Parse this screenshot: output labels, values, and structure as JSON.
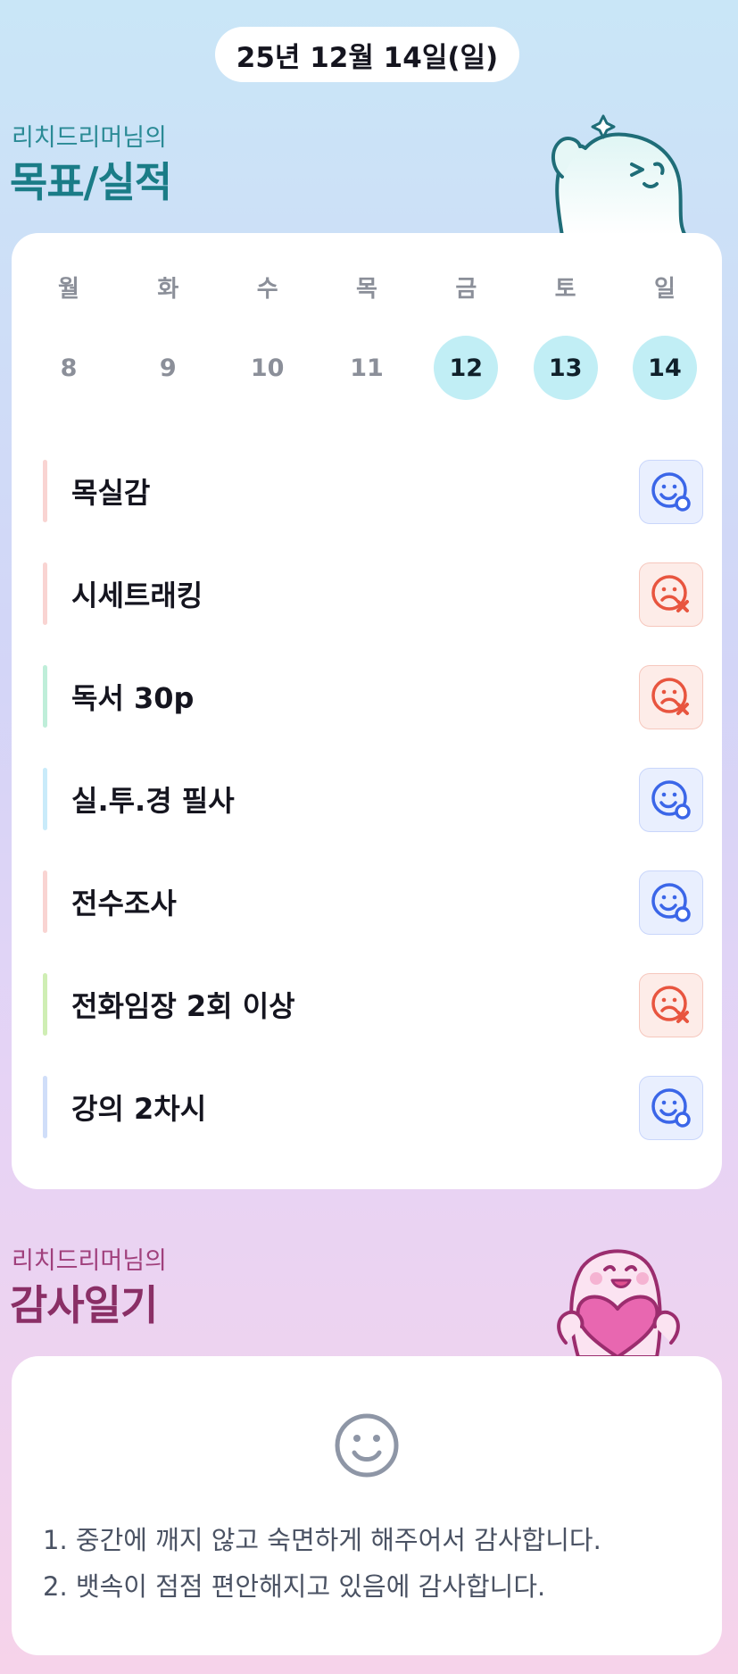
{
  "date": "25년 12월 14일(일)",
  "goals_section": {
    "subtitle": "리치드리머님의",
    "title": "목표/실적"
  },
  "week": {
    "days": [
      "월",
      "화",
      "수",
      "목",
      "금",
      "토",
      "일"
    ],
    "dates": [
      "8",
      "9",
      "10",
      "11",
      "12",
      "13",
      "14"
    ],
    "active": [
      "12",
      "13",
      "14"
    ]
  },
  "goals": [
    {
      "name": "목실감",
      "status": "done",
      "accent": "#f9d4d2"
    },
    {
      "name": "시세트래킹",
      "status": "failed",
      "accent": "#f9d4d2"
    },
    {
      "name": "독서 30p",
      "status": "failed",
      "accent": "#bfeed9"
    },
    {
      "name": "실.투.경 필사",
      "status": "done",
      "accent": "#c9ebfa"
    },
    {
      "name": "전수조사",
      "status": "done",
      "accent": "#f9d4d2"
    },
    {
      "name": "전화임장 2회 이상",
      "status": "failed",
      "accent": "#cfeeb4"
    },
    {
      "name": "강의 2차시",
      "status": "done",
      "accent": "#d0def9"
    }
  ],
  "gratitude_section": {
    "subtitle": "리치드리머님의",
    "title": "감사일기",
    "entries": [
      "1. 중간에 깨지 않고 숙면하게 해주어서 감사합니다.",
      "2. 뱃속이 점점 편안해지고 있음에 감사합니다."
    ]
  },
  "icons": {
    "done": "smile-check-icon",
    "failed": "sad-x-icon",
    "gratitude": "smile-face-icon"
  },
  "colors": {
    "done": "#3b66e8",
    "failed": "#e8553f",
    "active_date": "#c1eef5",
    "goal_title": "#1a7c87",
    "gratitude_title": "#8a2f66"
  }
}
